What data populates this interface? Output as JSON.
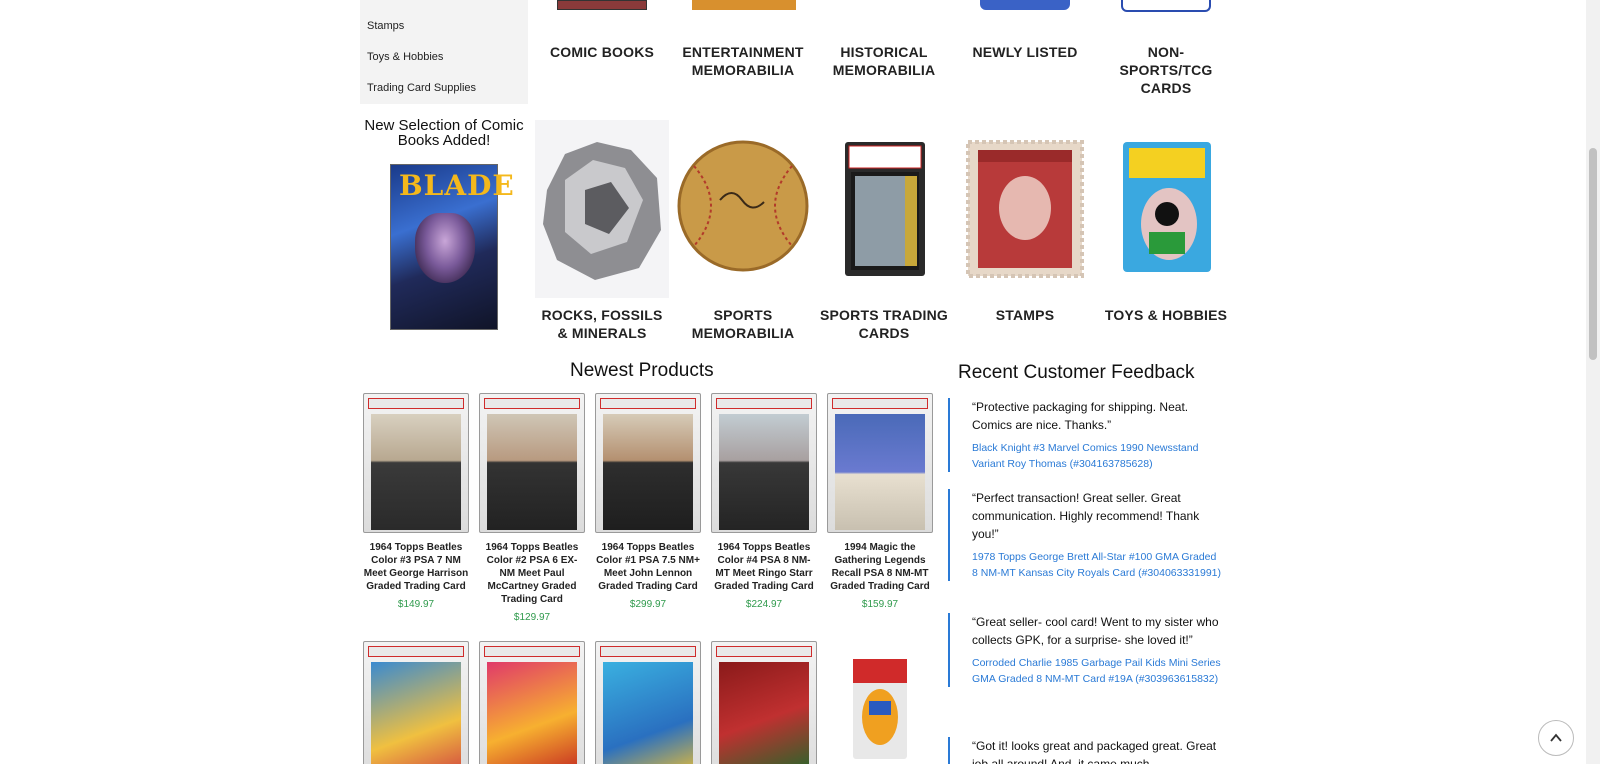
{
  "sidebar": {
    "items": [
      "Stamps",
      "Toys & Hobbies",
      "Trading Card Supplies"
    ]
  },
  "promo": {
    "title": "New Selection of Comic Books Added!",
    "cover_logo": "BLADE"
  },
  "categories_top": [
    {
      "label": "COMIC BOOKS"
    },
    {
      "label": "ENTERTAINMENT MEMORABILIA"
    },
    {
      "label": "HISTORICAL MEMORABILIA"
    },
    {
      "label": "NEWLY LISTED"
    },
    {
      "label": "NON-SPORTS/TCG CARDS"
    }
  ],
  "categories_bottom": [
    {
      "label": "ROCKS, FOSSILS & MINERALS"
    },
    {
      "label": "SPORTS MEMORABILIA"
    },
    {
      "label": "SPORTS TRADING CARDS"
    },
    {
      "label": "STAMPS"
    },
    {
      "label": "TOYS & HOBBIES"
    }
  ],
  "newest": {
    "title": "Newest Products",
    "products": [
      {
        "title": "1964 Topps Beatles Color #3 PSA 7 NM Meet George Harrison Graded Trading Card",
        "price": "$149.97"
      },
      {
        "title": "1964 Topps Beatles Color #2 PSA 6 EX-NM Meet Paul McCartney Graded Trading Card",
        "price": "$129.97"
      },
      {
        "title": "1964 Topps Beatles Color #1 PSA 7.5 NM+ Meet John Lennon Graded Trading Card",
        "price": "$299.97"
      },
      {
        "title": "1964 Topps Beatles Color #4 PSA 8 NM-MT Meet Ringo Starr Graded Trading Card",
        "price": "$224.97"
      },
      {
        "title": "1994 Magic the Gathering Legends Recall PSA 8 NM-MT Graded Trading Card",
        "price": "$159.97"
      }
    ]
  },
  "feedback": {
    "title": "Recent Customer Feedback",
    "entries": [
      {
        "quote": "“Protective packaging for shipping. Neat. Comics are nice. Thanks.”",
        "item": "Black Knight #3 Marvel Comics 1990 Newsstand Variant Roy Thomas (#304163785628)"
      },
      {
        "quote": "“Perfect transaction! Great seller. Great communication. Highly recommend! Thank you!”",
        "item": "1978 Topps George Brett All-Star #100 GMA Graded 8 NM-MT Kansas City Royals Card (#304063331991)"
      },
      {
        "quote": "“Great seller- cool card! Went to my sister who collects GPK, for a surprise- she loved it!”",
        "item": "Corroded Charlie 1985 Garbage Pail Kids Mini Series GMA Graded 8 NM-MT Card #19A (#303963615832)"
      },
      {
        "quote": "“Got it! looks great and packaged great. Great job all around! And, it came much",
        "item": ""
      }
    ]
  },
  "colors": {
    "link": "#2a7ad6",
    "price": "#2f9a4c"
  }
}
